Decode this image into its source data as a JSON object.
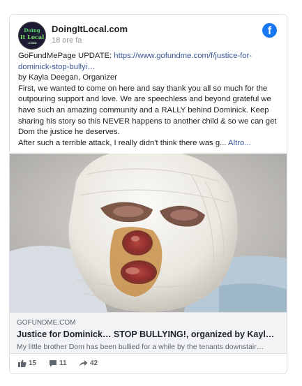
{
  "post": {
    "page_name": "DoingItLocal.com",
    "time": "18 ore fa",
    "avatar_text": [
      "Doing",
      "It Local",
      ".com"
    ],
    "text": {
      "line1_prefix": "GoFundMePage UPDATE: ",
      "link": "https://www.gofundme.com/f/justice-for-dominick-stop-bullyi…",
      "organizer": "by Kayla Deegan, Organizer",
      "paragraph": "First, we wanted to come on here and say thank you all so much for the outpouring support and love. We are speechless and beyond grateful we have such an amazing community and a RALLY behind Dominick. Keep sharing his story so this NEVER happens to another child & so we can get Dom the justice he deserves.",
      "last_line": "After such a terrible attack, I really didn't think there was g...",
      "more": "Altro..."
    }
  },
  "link_preview": {
    "domain": "GOFUNDME.COM",
    "title": "Justice for Dominick… STOP BULLYING!, organized by Kayl…",
    "description": "My little brother Dom has been bullied for a while by the tenants downstair…"
  },
  "stats": {
    "likes": "15",
    "comments": "11",
    "shares": "42"
  },
  "icons": {
    "facebook": "facebook-logo-icon",
    "like": "thumbs-up-icon",
    "comment": "comment-icon",
    "share": "share-arrow-icon"
  },
  "colors": {
    "facebook_blue": "#1877f2",
    "link": "#385898",
    "muted": "#606770"
  }
}
